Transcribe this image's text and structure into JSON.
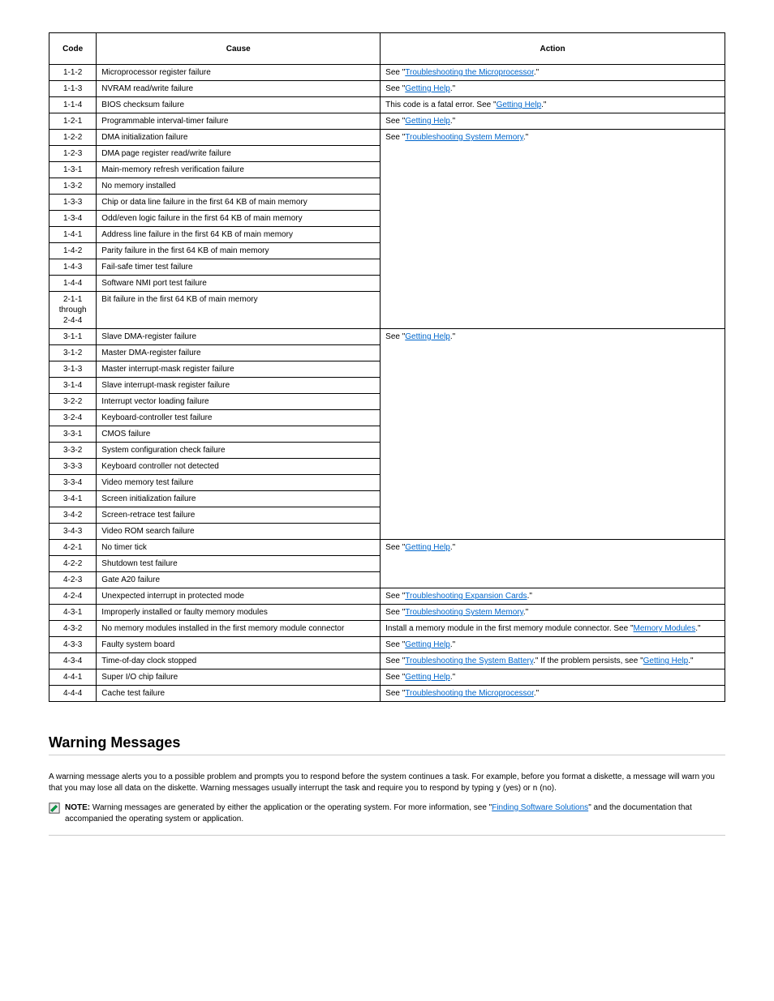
{
  "table": {
    "headers": [
      "Code",
      "Cause",
      "Action"
    ],
    "rows": [
      [
        "1-1-2",
        "Microprocessor register failure",
        "See \"<a href='#'>Troubleshooting the Microprocessor</a>.\""
      ],
      [
        "1-1-3",
        "NVRAM read/write failure",
        "See \"<a href='#'>Getting Help</a>.\""
      ],
      [
        "1-1-4",
        "BIOS checksum failure",
        "This code is a fatal error. See \"<a href='#'>Getting Help</a>.\""
      ],
      [
        "1-2-1",
        "Programmable interval-timer failure",
        "See \"<a href='#'>Getting Help</a>.\""
      ],
      [
        "1-2-2",
        "DMA initialization failure",
        "See \"<a href='#'>Troubleshooting System Memory</a>.\""
      ],
      [
        "1-2-3",
        "DMA page register read/write failure",
        ""
      ],
      [
        "1-3-1",
        "Main-memory refresh verification failure",
        ""
      ],
      [
        "1-3-2",
        "No memory installed",
        ""
      ],
      [
        "1-3-3",
        "Chip or data line failure in the first 64 KB of main memory",
        ""
      ],
      [
        "1-3-4",
        "Odd/even logic failure in the first 64 KB of main memory",
        ""
      ],
      [
        "1-4-1",
        "Address line failure in the first 64 KB of main memory",
        ""
      ],
      [
        "1-4-2",
        "Parity failure in the first 64 KB of main memory",
        ""
      ],
      [
        "1-4-3",
        "Fail-safe timer test failure",
        ""
      ],
      [
        "1-4-4",
        "Software NMI port test failure",
        ""
      ],
      [
        "2-1-1 through 2-4-4",
        "Bit failure in the first 64 KB of main memory",
        ""
      ],
      [
        "3-1-1",
        "Slave DMA-register failure",
        "See \"<a href='#'>Getting Help</a>.\""
      ],
      [
        "3-1-2",
        "Master DMA-register failure",
        ""
      ],
      [
        "3-1-3",
        "Master interrupt-mask register failure",
        ""
      ],
      [
        "3-1-4",
        "Slave interrupt-mask register failure",
        ""
      ],
      [
        "3-2-2",
        "Interrupt vector loading failure",
        ""
      ],
      [
        "3-2-4",
        "Keyboard-controller test failure",
        ""
      ],
      [
        "3-3-1",
        "CMOS failure",
        ""
      ],
      [
        "3-3-2",
        "System configuration check failure",
        ""
      ],
      [
        "3-3-3",
        "Keyboard controller not detected",
        ""
      ],
      [
        "3-3-4",
        "Video memory test failure",
        ""
      ],
      [
        "3-4-1",
        "Screen initialization failure",
        ""
      ],
      [
        "3-4-2",
        "Screen-retrace test failure",
        ""
      ],
      [
        "3-4-3",
        "Video ROM search failure",
        ""
      ],
      [
        "4-2-1",
        "No timer tick",
        "See \"<a href='#'>Getting Help</a>.\""
      ],
      [
        "4-2-2",
        "Shutdown test failure",
        ""
      ],
      [
        "4-2-3",
        "Gate A20 failure",
        ""
      ],
      [
        "4-2-4",
        "Unexpected interrupt in protected mode",
        "See \"<a href='#'>Troubleshooting Expansion Cards</a>.\""
      ],
      [
        "4-3-1",
        "Improperly installed or faulty memory modules",
        "See \"<a href='#'>Troubleshooting System Memory</a>.\""
      ],
      [
        "4-3-2",
        "No memory modules installed in the first memory module connector",
        "Install a memory module in the first memory module connector. See \"<a href='#'>Memory Modules</a>.\""
      ],
      [
        "4-3-3",
        "Faulty system board",
        "See \"<a href='#'>Getting Help</a>.\""
      ],
      [
        "4-3-4",
        "Time-of-day clock stopped",
        "See \"<a href='#'>Troubleshooting the System Battery</a>.\" If the problem persists, see \"<a href='#'>Getting Help</a>.\""
      ],
      [
        "4-4-1",
        "Super I/O chip failure",
        "See \"<a href='#'>Getting Help</a>.\""
      ],
      [
        "4-4-4",
        "Cache test failure",
        "See \"<a href='#'>Troubleshooting the Microprocessor</a>.\""
      ]
    ]
  },
  "section": {
    "title": "Warning Messages",
    "para": "A warning message alerts you to a possible problem and prompts you to respond before the system continues a task. For example, before you format a diskette, a message will warn you that you may lose all data on the diskette. Warning messages usually interrupt the task and require you to respond by typing <code>y</code> (yes) or <code>n</code> (no).",
    "note_label": "NOTE:",
    "note_text": " Warning messages are generated by either the application or the operating system. For more information, see \"",
    "note_link": "Finding Software Solutions",
    "note_tail": "\" and the documentation that accompanied the operating system or application."
  }
}
